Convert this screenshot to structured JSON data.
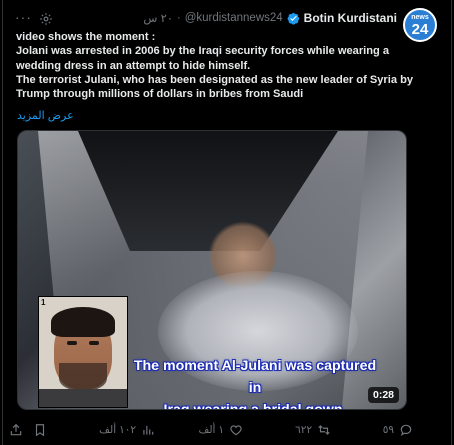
{
  "header": {
    "avatar_top": "news",
    "avatar_num": "24",
    "display_name": "Botin Kurdistani",
    "handle": "@kurdistannews24",
    "separator": "·",
    "time": "٢٠ س"
  },
  "tweet": {
    "lines": [
      "video shows the moment :",
      "Jolani was arrested in 2006 by the Iraqi security forces while wearing a",
      "wedding dress in an attempt to hide himself.",
      "The terrorist Julani, who has been designated as the new leader of Syria by",
      "Trump through millions of dollars in bribes from Saudi"
    ],
    "show_more": "عرض المزيد"
  },
  "media": {
    "caption_line1": "The moment Al-Julani was captured in",
    "caption_line2": "Iraq wearing a bridal gown.",
    "duration": "0:28",
    "inset_corner": "1"
  },
  "actions": {
    "replies": "٥٩",
    "retweets": "٦٢٢",
    "likes": "١ ألف",
    "views": "١٠٢ ألف"
  },
  "colors": {
    "background": "#000000",
    "text": "#e7e9ea",
    "muted": "#71767b",
    "link": "#1d9bf0",
    "verified": "#1d9bf0"
  },
  "icons": [
    "verified-badge-icon",
    "settings-icon",
    "more-icon",
    "reply-icon",
    "retweet-icon",
    "like-icon",
    "views-icon",
    "bookmark-icon",
    "share-icon"
  ]
}
